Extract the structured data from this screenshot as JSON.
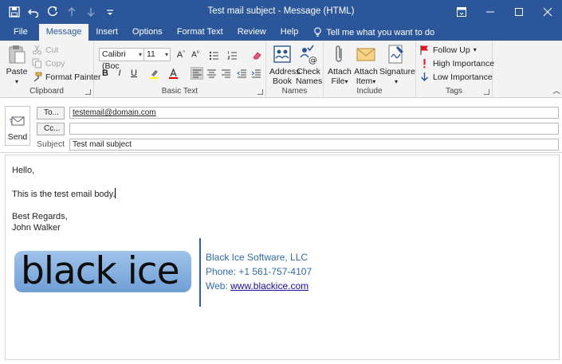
{
  "window": {
    "title": "Test mail subject  -  Message (HTML)"
  },
  "tabs": [
    {
      "label": "File"
    },
    {
      "label": "Message"
    },
    {
      "label": "Insert"
    },
    {
      "label": "Options"
    },
    {
      "label": "Format Text"
    },
    {
      "label": "Review"
    },
    {
      "label": "Help"
    }
  ],
  "tell_me": "Tell me what you want to do",
  "ribbon": {
    "clipboard": {
      "label": "Clipboard",
      "paste": "Paste",
      "cut": "Cut",
      "copy": "Copy",
      "format_painter": "Format Painter"
    },
    "basic_text": {
      "label": "Basic Text",
      "font": "Calibri (Boc",
      "size": "11"
    },
    "names": {
      "label": "Names",
      "address_book_1": "Address",
      "address_book_2": "Book",
      "check_names_1": "Check",
      "check_names_2": "Names"
    },
    "include": {
      "label": "Include",
      "attach_file_1": "Attach",
      "attach_file_2": "File",
      "attach_item_1": "Attach",
      "attach_item_2": "Item",
      "signature_1": "Signature"
    },
    "tags": {
      "label": "Tags",
      "follow_up": "Follow Up",
      "high": "High Importance",
      "low": "Low Importance"
    }
  },
  "header": {
    "send": "Send",
    "to_button": "To...",
    "cc_button": "Cc...",
    "subject_label": "Subject",
    "to_value": "testemail@domain.com",
    "cc_value": "",
    "subject_value": "Test mail subject"
  },
  "body": {
    "greeting": "Hello,",
    "content": "This is the test email body.",
    "regards": "Best Regards,",
    "name": "John Walker"
  },
  "signature": {
    "logo_text": "black ice",
    "company": "Black Ice Software, LLC",
    "phone": "Phone: +1 561-757-4107",
    "web_label": "Web: ",
    "web_link": "www.blackice.com"
  },
  "colors": {
    "accent": "#2b579a",
    "link": "#1a0dab",
    "signature_text": "#2f6aad"
  }
}
